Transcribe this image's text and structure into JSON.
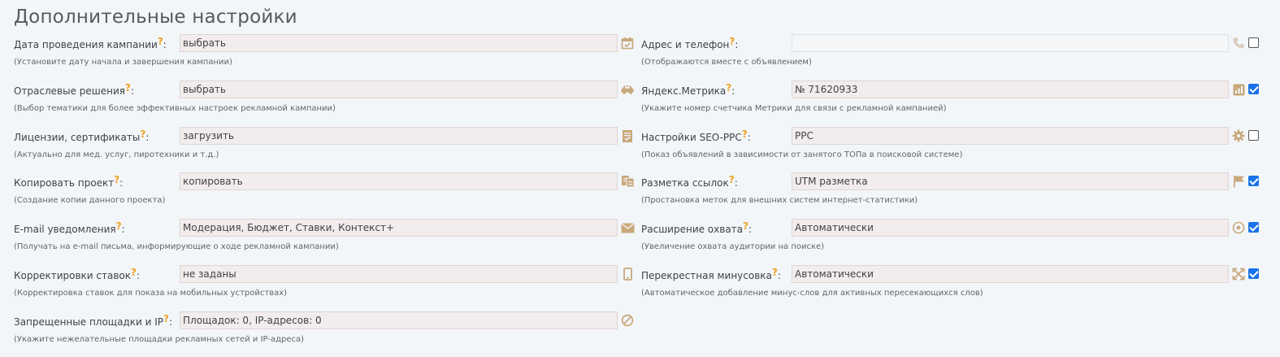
{
  "page_title": "Дополнительные настройки",
  "left": [
    {
      "label": "Дата проведения кампании",
      "hint": "(Установите дату начала и завершения кампании)",
      "value": "выбрать",
      "icon": "calendar-icon"
    },
    {
      "label": "Отраслевые решения",
      "hint": "(Выбор тематики для более эффективных настроек рекламной кампании)",
      "value": "выбрать",
      "icon": "car-icon"
    },
    {
      "label": "Лицензии, сертификаты",
      "hint": "(Актуально для мед. услуг, пиротехники и т.д.)",
      "value": "загрузить",
      "icon": "certificate-icon"
    },
    {
      "label": "Копировать проект",
      "hint": "(Создание копии данного проекта)",
      "value": "копировать",
      "icon": "copy-icon"
    },
    {
      "label": "E-mail уведомления",
      "hint": "(Получать на e-mail письма, информирующие о ходе рекламной кампании)",
      "value": "Модерация, Бюджет, Ставки, Контекст+",
      "icon": "envelope-icon"
    },
    {
      "label": "Корректировки ставок",
      "hint": "(Корректировка ставок для показа на мобильных устройствах)",
      "value": "не заданы",
      "icon": "mobile-icon"
    },
    {
      "label": "Запрещенные площадки и IP",
      "hint": "(Укажите нежелательные площадки рекламных сетей и IP-адреса)",
      "value": "Площадок: 0, IP-адресов: 0",
      "icon": "ban-icon"
    }
  ],
  "right": [
    {
      "label": "Адрес и телефон",
      "hint": "(Отображаются вместе с объявлением)",
      "value": "",
      "icon": "phone-icon",
      "checked": false
    },
    {
      "label": "Яндекс.Метрика",
      "hint": "(Укажите номер счетчика Метрики для связи с рекламной кампанией)",
      "value": "№ 71620933",
      "icon": "metrika-icon",
      "checked": true
    },
    {
      "label": "Настройки SEO-PPC",
      "hint": "(Показ объявлений в зависимости от занятого ТОПа в поисковой системе)",
      "value": "PPC",
      "icon": "gear-icon",
      "checked": false
    },
    {
      "label": "Разметка ссылок",
      "hint": "(Простановка меток для внешних систем интернет-статистики)",
      "value": "UTM разметка",
      "icon": "flag-icon",
      "checked": true
    },
    {
      "label": "Расширение охвата",
      "hint": "(Увеличение охвата аудитории на поиске)",
      "value": "Автоматически",
      "icon": "target-icon",
      "checked": true
    },
    {
      "label": "Перекрестная минусовка",
      "hint": "(Автоматическое добавление минус-слов для активных пересекающихся слов)",
      "value": "Автоматически",
      "icon": "cross-arrows-icon",
      "checked": true
    }
  ],
  "help_mark": "?",
  "colors": {
    "icon": "#c9a87c",
    "icon_muted": "#b9bec3",
    "help": "#f0a020",
    "checkbox_on": "#1a73e8"
  }
}
